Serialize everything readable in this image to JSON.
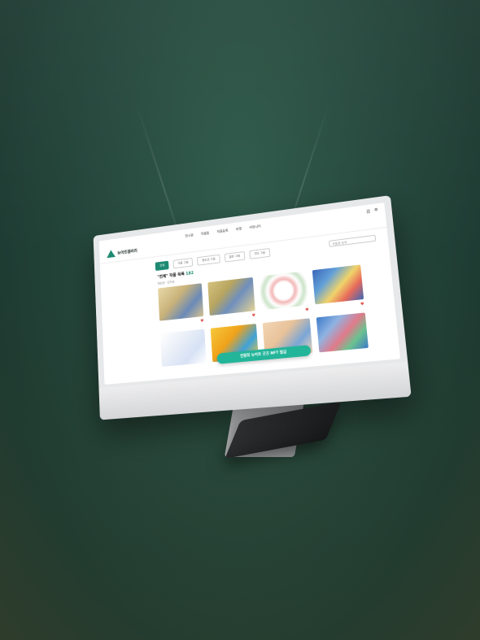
{
  "site": {
    "logo_text": "뉴아트갤러리",
    "nav": [
      "전시관",
      "작품들",
      "작품등록",
      "마켓",
      "커뮤니티"
    ],
    "util": [
      "검",
      "⚙"
    ]
  },
  "filters": {
    "chips": [
      "전체",
      "아동 그림",
      "청소년 그림",
      "일반 그림",
      "기타 그림"
    ],
    "search_placeholder": "작품명 검색"
  },
  "result": {
    "prefix": "\"전체\" 작품 목록",
    "count": "182",
    "sort_label": "최신순 · 인기순"
  },
  "artworks": [
    {
      "title": "",
      "artist": "",
      "liked": true
    },
    {
      "title": "",
      "artist": "",
      "liked": true
    },
    {
      "title": "",
      "artist": "",
      "liked": true
    },
    {
      "title": "",
      "artist": "",
      "liked": true
    },
    {
      "title": "",
      "artist": "",
      "liked": true
    },
    {
      "title": "",
      "artist": "",
      "liked": true
    },
    {
      "title": "",
      "artist": "",
      "liked": true
    },
    {
      "title": "",
      "artist": "",
      "liked": true
    }
  ],
  "banner": {
    "label": "전람회 뉴아트 굿즈 NFT 발급"
  },
  "colors": {
    "brand": "#1e8a72",
    "banner": "#23b59a",
    "heart": "#e0554f",
    "background": "#24463b"
  },
  "icons": {
    "logo": "triangle-logo-icon",
    "heart": "heart-icon",
    "search": "search-icon"
  }
}
